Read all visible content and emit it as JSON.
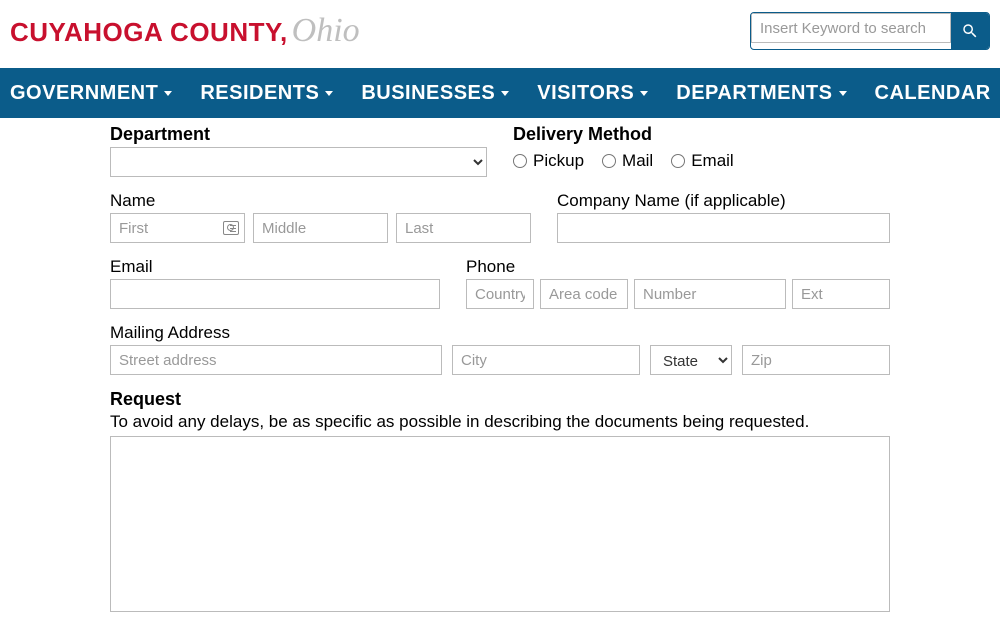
{
  "header": {
    "logo_main": "CUYAHOGA COUNTY,",
    "logo_script": "Ohio",
    "search_placeholder": "Insert Keyword to search"
  },
  "nav": {
    "items": [
      {
        "label": "GOVERNMENT",
        "has_dropdown": true
      },
      {
        "label": "RESIDENTS",
        "has_dropdown": true
      },
      {
        "label": "BUSINESSES",
        "has_dropdown": true
      },
      {
        "label": "VISITORS",
        "has_dropdown": true
      },
      {
        "label": "DEPARTMENTS",
        "has_dropdown": true
      },
      {
        "label": "CALENDAR",
        "has_dropdown": false
      }
    ]
  },
  "form": {
    "department_label": "Department",
    "delivery_label": "Delivery Method",
    "delivery_options": {
      "pickup": "Pickup",
      "mail": "Mail",
      "email": "Email"
    },
    "name_label": "Name",
    "name_first_placeholder": "First",
    "name_middle_placeholder": "Middle",
    "name_last_placeholder": "Last",
    "company_label": "Company Name (if applicable)",
    "email_label": "Email",
    "phone_label": "Phone",
    "phone_country_placeholder": "Country",
    "phone_area_placeholder": "Area code",
    "phone_number_placeholder": "Number",
    "phone_ext_placeholder": "Ext",
    "mailing_label": "Mailing Address",
    "street_placeholder": "Street address",
    "city_placeholder": "City",
    "state_placeholder": "State",
    "zip_placeholder": "Zip",
    "request_label": "Request",
    "request_helper": "To avoid any delays, be as specific as possible in describing the documents being requested."
  }
}
